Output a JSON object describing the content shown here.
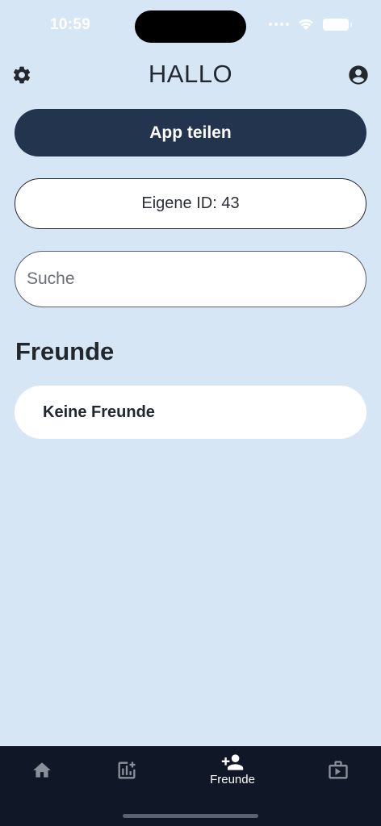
{
  "status_bar": {
    "time": "10:59"
  },
  "header": {
    "title": "HALLO",
    "settings_icon": "gear-icon",
    "profile_icon": "account-circle-icon"
  },
  "share_button": {
    "label": "App teilen"
  },
  "own_id": {
    "label": "Eigene ID: 43"
  },
  "search": {
    "placeholder": "Suche",
    "value": ""
  },
  "friends_section": {
    "title": "Freunde",
    "empty_text": "Keine Freunde"
  },
  "bottom_nav": {
    "items": [
      {
        "icon": "home-icon",
        "label": ""
      },
      {
        "icon": "chart-add-icon",
        "label": ""
      },
      {
        "icon": "person-add-icon",
        "label": "Freunde",
        "active": true
      },
      {
        "icon": "media-library-icon",
        "label": ""
      }
    ]
  },
  "colors": {
    "background": "#d7e6f5",
    "primary": "#23344f",
    "nav_background": "#101828"
  }
}
